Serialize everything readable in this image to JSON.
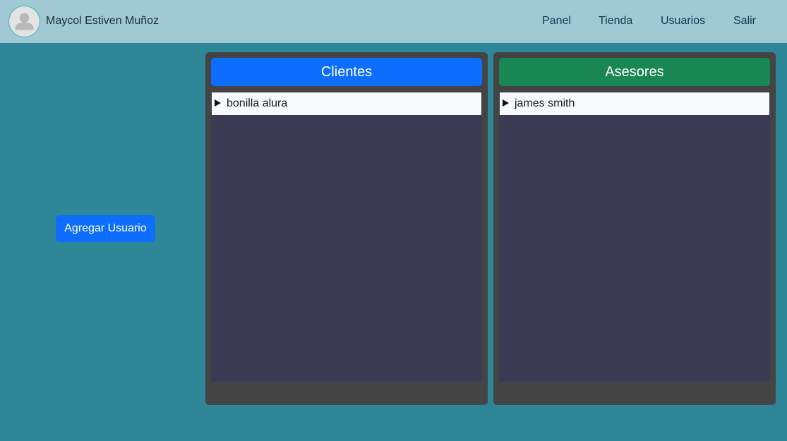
{
  "header": {
    "user_name": "Maycol Estiven Muñoz",
    "avatar_icon": "user-avatar-icon",
    "nav": [
      "Panel",
      "Tienda",
      "Usuarios",
      "Salir"
    ]
  },
  "actions": {
    "add_user_label": "Agregar Usuario"
  },
  "panels": {
    "clientes": {
      "title": "Clientes",
      "color": "#0d6efd",
      "items": [
        "bonilla alura"
      ]
    },
    "asesores": {
      "title": "Asesores",
      "color": "#198754",
      "items": [
        "james smith"
      ]
    }
  },
  "colors": {
    "background": "#2e8799",
    "navbar": "#a0c9d3",
    "panel": "#444444",
    "panel_body": "#3a3a52",
    "button": "#0d6efd"
  }
}
